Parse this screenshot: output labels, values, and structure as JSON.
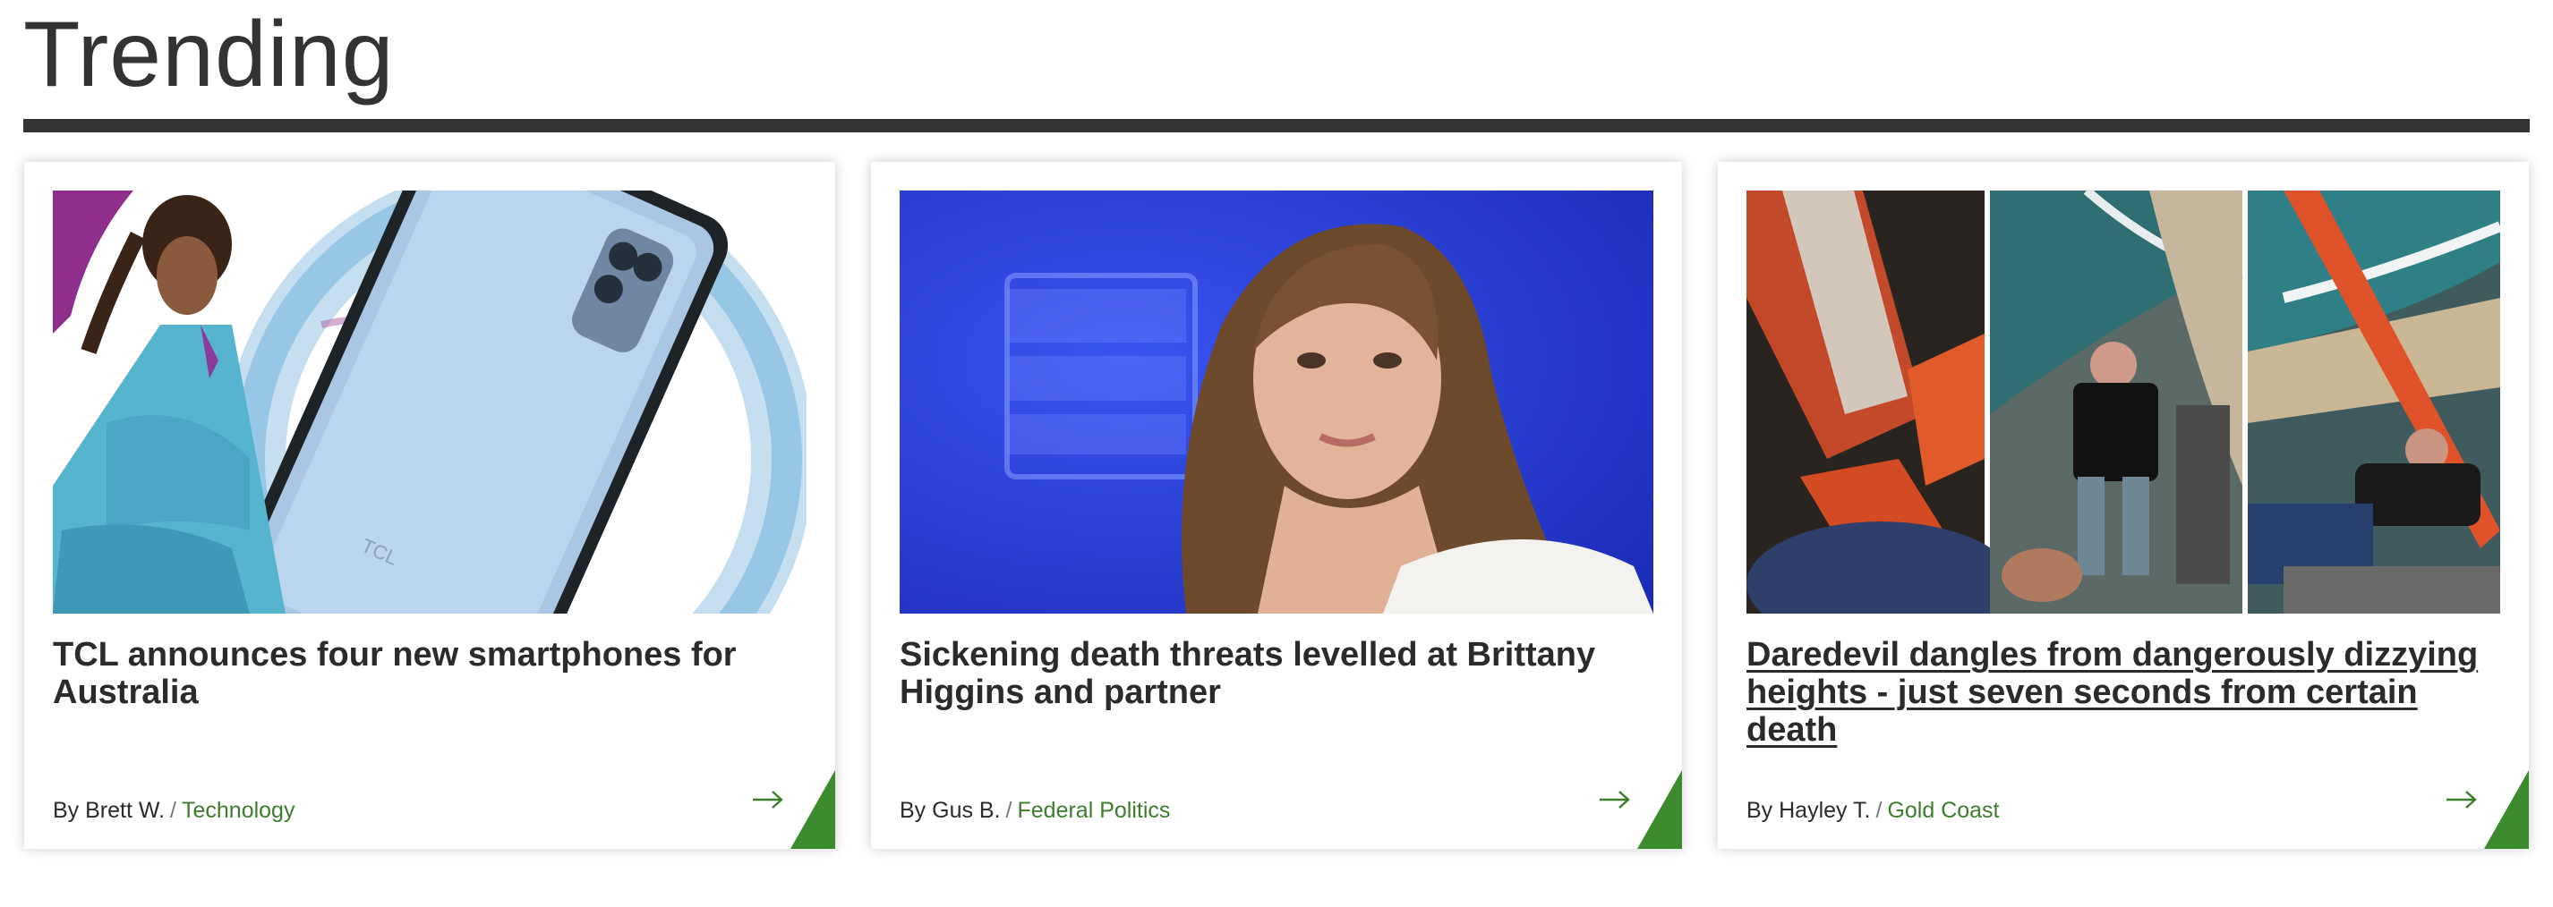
{
  "section": {
    "title": "Trending"
  },
  "colors": {
    "accent": "#3d8b2f",
    "category_text": "#3d7d2e",
    "rule": "#333333"
  },
  "articles": [
    {
      "headline": "TCL announces four new smartphones for Australia",
      "author": "By Brett W.",
      "separator": "/",
      "category": "Technology",
      "image": "phone-and-model-photo",
      "arrow_icon": "arrow-right-icon"
    },
    {
      "headline": "Sickening death threats levelled at Brittany Higgins and partner",
      "author": "By Gus B.",
      "separator": "/",
      "category": "Federal Politics",
      "image": "woman-at-press-club-photo",
      "arrow_icon": "arrow-right-icon"
    },
    {
      "headline": "Daredevil dangles from dangerously dizzying heights - just seven seconds from certain death",
      "author": "By Hayley T.",
      "separator": "/",
      "category": "Gold Coast",
      "image": "daredevil-crane-collage-photo",
      "arrow_icon": "arrow-right-icon"
    }
  ]
}
